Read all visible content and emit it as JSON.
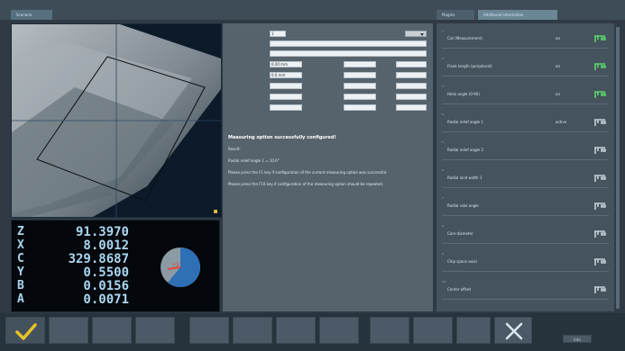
{
  "header": {
    "tab_main": "Scenario",
    "tab_plugins": "Plugins",
    "tab_info": "Additional information"
  },
  "dro": {
    "rows": [
      {
        "axis": "Z",
        "value": "91.3970"
      },
      {
        "axis": "X",
        "value": "8.0012"
      },
      {
        "axis": "C",
        "value": "329.8687"
      },
      {
        "axis": "Y",
        "value": "0.5500"
      },
      {
        "axis": "B",
        "value": "0.0156"
      },
      {
        "axis": "A",
        "value": "0.0071"
      }
    ],
    "gauge_marker": "+1"
  },
  "message": {
    "title": "Measuring option successfully configured!",
    "result_label": "Result:",
    "result_value": "Radial relief angle 1 = 10.6°",
    "hint1": "Please press the F1 key if configuration of the current measuring option was successful.",
    "hint2": "Please press the F10 key if configuration of the measuring option should be repeated."
  },
  "form": {
    "field_values": [
      "1",
      "",
      "",
      "0.00 mm",
      "0.0 mm"
    ]
  },
  "right_panel": {
    "items": [
      {
        "num": "1",
        "label": "Cut (Measurement)",
        "value": "on",
        "tool_active": true
      },
      {
        "num": "2",
        "label": "Flank length (peripheral)",
        "value": "on",
        "tool_active": true
      },
      {
        "num": "3",
        "label": "Helix angle (0-90)",
        "value": "on",
        "tool_active": true
      },
      {
        "num": "4",
        "label": "Radial relief angle 1",
        "value": "active",
        "tool_active": false
      },
      {
        "num": "5",
        "label": "Radial relief angle 2",
        "value": "",
        "tool_active": false
      },
      {
        "num": "6",
        "label": "Radial land width 1",
        "value": "",
        "tool_active": false
      },
      {
        "num": "7",
        "label": "Radial rake angle",
        "value": "",
        "tool_active": false
      },
      {
        "num": "8",
        "label": "Core diameter",
        "value": "",
        "tool_active": false
      },
      {
        "num": "9",
        "label": "Chip space axial",
        "value": "",
        "tool_active": false
      },
      {
        "num": "10",
        "label": "Center offset",
        "value": "",
        "tool_active": false
      }
    ]
  },
  "toolbar": {
    "ok_icon": "checkmark-icon",
    "cancel_icon": "close-icon",
    "status_label": "Info"
  },
  "colors": {
    "accent_yellow": "#e8c22a",
    "tool_green": "#5bd36b",
    "dro_text": "#a9d6f1"
  }
}
